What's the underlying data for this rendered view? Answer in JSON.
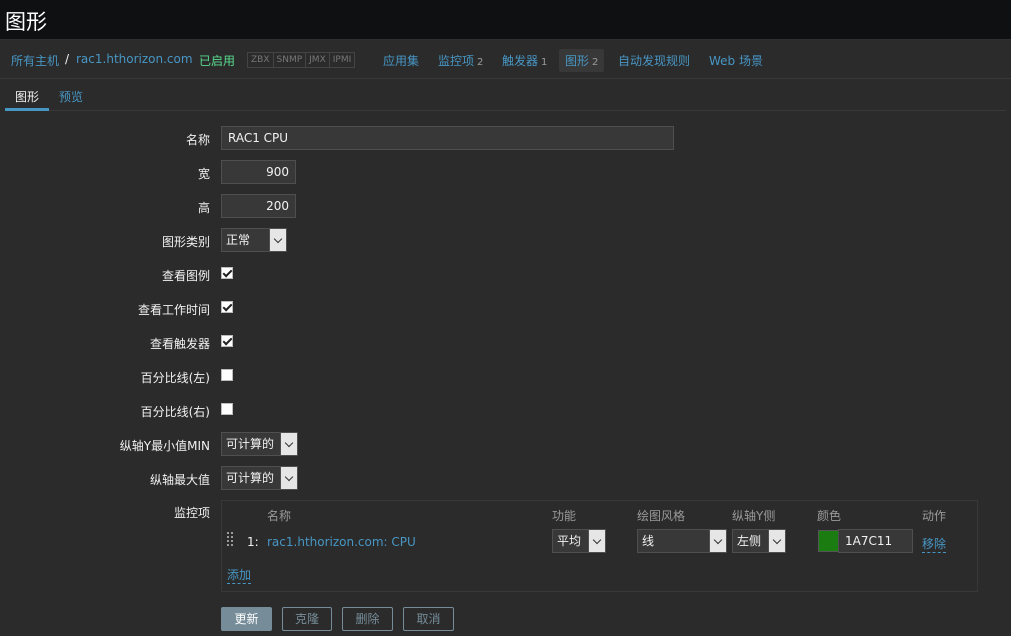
{
  "page_title": "图形",
  "nav": {
    "all_hosts": "所有主机",
    "separator": "/",
    "host": "rac1.hthorizon.com",
    "status": "已启用",
    "badges": [
      "ZBX",
      "SNMP",
      "JMX",
      "IPMI"
    ],
    "applications": "应用集",
    "items": "监控项",
    "items_count": "2",
    "triggers": "触发器",
    "triggers_count": "1",
    "graphs": "图形",
    "graphs_count": "2",
    "discovery": "自动发现规则",
    "web": "Web 场景"
  },
  "tabs": {
    "graph": "图形",
    "preview": "预览"
  },
  "form": {
    "name_label": "名称",
    "name_value": "RAC1 CPU",
    "width_label": "宽",
    "width_value": "900",
    "height_label": "高",
    "height_value": "200",
    "type_label": "图形类别",
    "type_value": "正常",
    "show_legend_label": "查看图例",
    "show_legend": true,
    "show_work_period_label": "查看工作时间",
    "show_work_period": true,
    "show_triggers_label": "查看触发器",
    "show_triggers": true,
    "percentile_left_label": "百分比线(左)",
    "percentile_left": false,
    "percentile_right_label": "百分比线(右)",
    "percentile_right": false,
    "ymin_label": "纵轴Y最小值MIN",
    "ymin_value": "可计算的",
    "ymax_label": "纵轴最大值",
    "ymax_value": "可计算的",
    "items_label": "监控项"
  },
  "items_table": {
    "headers": {
      "name": "名称",
      "function": "功能",
      "style": "绘图风格",
      "yaxis": "纵轴Y侧",
      "color": "颜色",
      "action": "动作"
    },
    "rows": [
      {
        "index": "1:",
        "name": "rac1.hthorizon.com: CPU",
        "function": "平均",
        "style": "线",
        "yaxis": "左侧",
        "color": "1A7C11",
        "action": "移除"
      }
    ],
    "add": "添加"
  },
  "buttons": {
    "update": "更新",
    "clone": "克隆",
    "delete": "删除",
    "cancel": "取消"
  },
  "colors": {
    "accent": "#4796c4",
    "enabled": "#59db8f",
    "swatch": "#1A7C11"
  }
}
